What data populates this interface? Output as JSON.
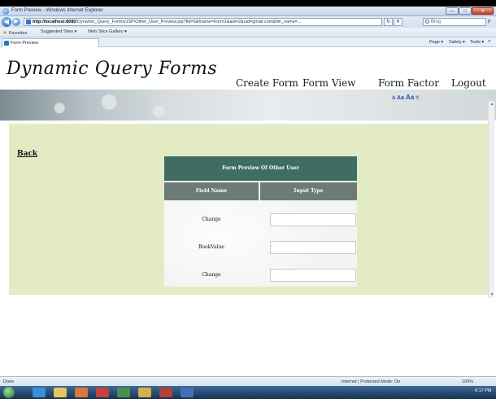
{
  "window": {
    "title": "Form Preview - Windows Internet Explorer",
    "minimize_label": "—",
    "maximize_label": "□",
    "close_label": "✕"
  },
  "address_bar": {
    "url_host": "http://localhost:8080",
    "url_path": "/Dynamic_Query_Forms/JSP/Other_User_Preview.jsp?fid=5&fname=Form1&aid=2&uid=gmail.com&fiin_name=...",
    "back_label": "◀",
    "forward_label": "▶",
    "refresh_label": "↻",
    "stop_label": "✕",
    "search_placeholder": "Bing",
    "search_go": "ρ"
  },
  "favorites_bar": {
    "favorites_label": "Favorites",
    "items": [
      "Suggested Sites ▾",
      "Web Slice Gallery ▾"
    ]
  },
  "tab_bar": {
    "tab_label": "Form Preview",
    "commands": [
      "Page ▾",
      "Safety ▾",
      "Tools ▾",
      "?"
    ]
  },
  "site": {
    "title": "Dynamic Query Forms",
    "text_size": [
      "A",
      "Aa",
      "Aa",
      "!!"
    ],
    "menu": [
      "Create Form",
      "Form View",
      "Form Factor",
      "Logout"
    ],
    "back_label": "Back"
  },
  "form_preview": {
    "heading": "Form Preview Of Other User",
    "columns": [
      "Field Name",
      "Input Type"
    ],
    "rows": [
      {
        "field": "Change",
        "value": ""
      },
      {
        "field": "BookValue",
        "value": ""
      },
      {
        "field": "Change",
        "value": ""
      }
    ]
  },
  "status_bar": {
    "left": "Done",
    "zone": "Internet | Protected Mode: On",
    "zoom": "100%"
  },
  "taskbar": {
    "clock": "6:17 PM"
  },
  "colors": {
    "content_bg": "#e3ebc4",
    "card_header": "#3f6d62",
    "column_header": "#6b7b78",
    "link_blue": "#2b4aa8"
  }
}
